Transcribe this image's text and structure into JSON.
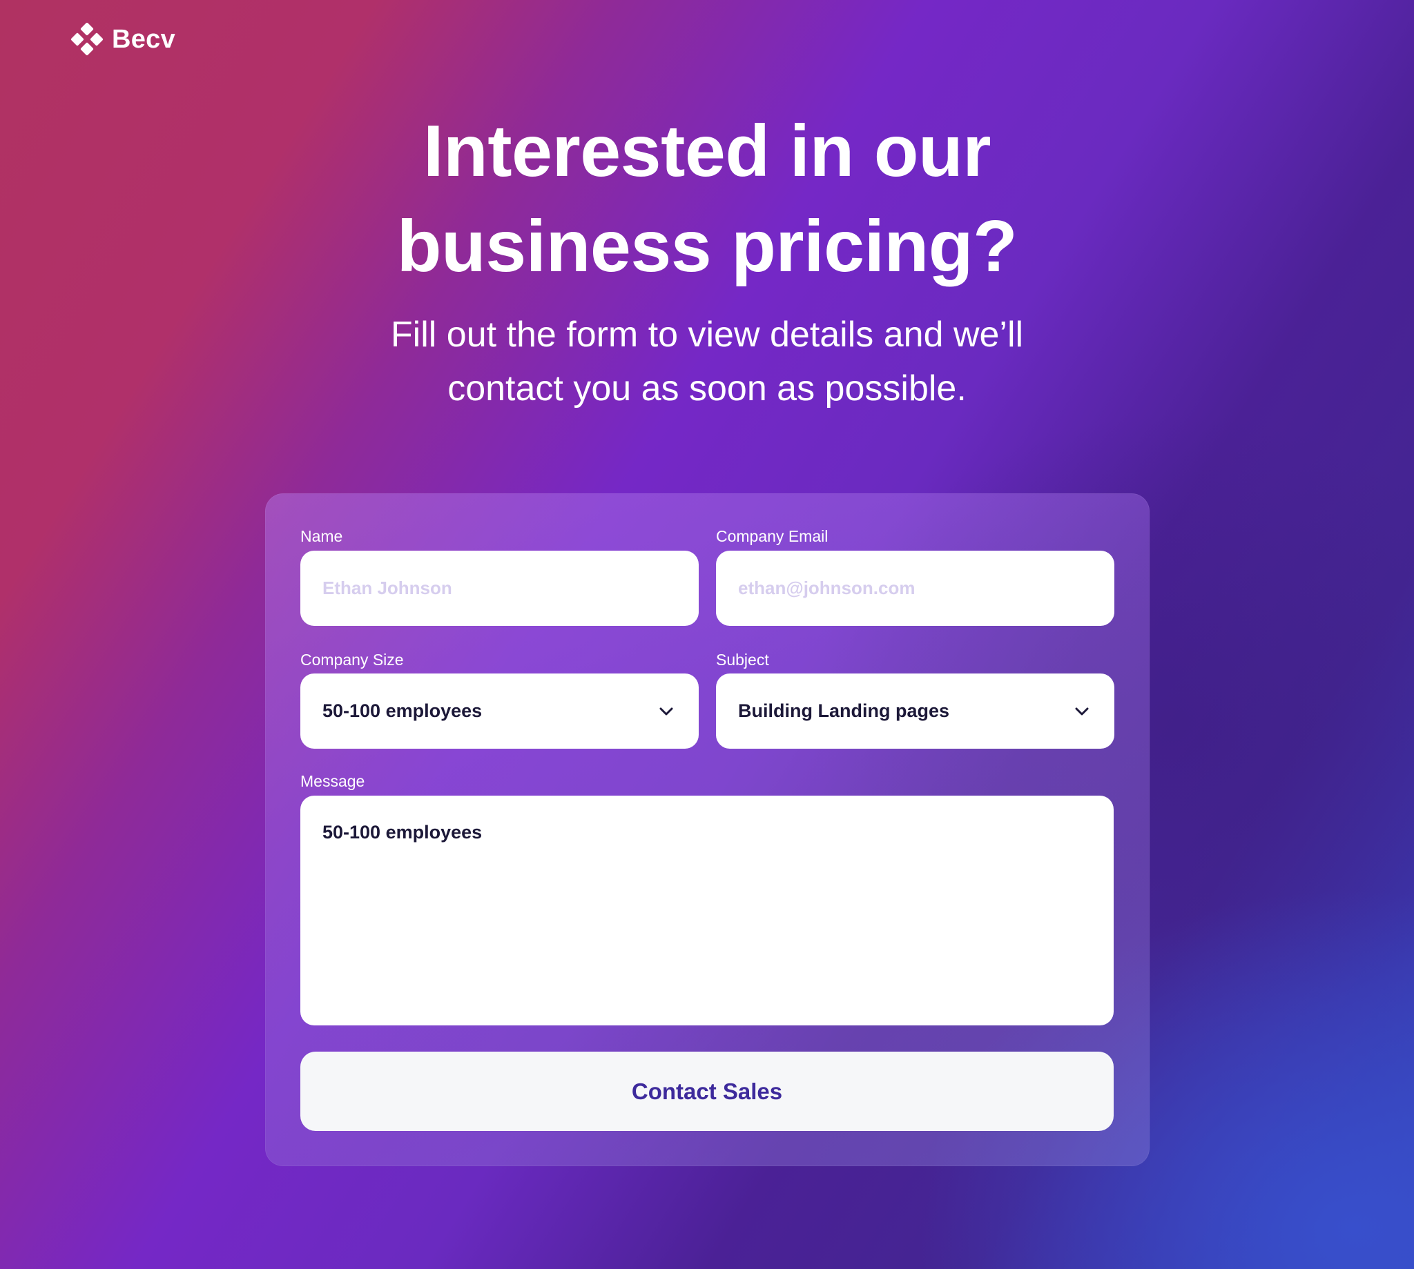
{
  "brand": {
    "name": "Becv",
    "logo_icon": "diamond-grid-logo-icon"
  },
  "hero": {
    "title_line1": "Interested in our",
    "title_line2": "business pricing?",
    "subtitle_line1": "Fill out the form to view details and we’ll",
    "subtitle_line2": "contact you as soon as possible."
  },
  "form": {
    "name": {
      "label": "Name",
      "placeholder": "Ethan Johnson",
      "value": ""
    },
    "email": {
      "label": "Company Email",
      "placeholder": "ethan@johnson.com",
      "value": ""
    },
    "company_size": {
      "label": "Company Size",
      "selected": "50-100 employees",
      "icon": "chevron-down-icon"
    },
    "subject": {
      "label": "Subject",
      "selected": "Building Landing pages",
      "icon": "chevron-down-icon"
    },
    "message": {
      "label": "Message",
      "value": "50-100 employees"
    },
    "submit_label": "Contact Sales"
  },
  "colors": {
    "gradient_start": "#b03262",
    "gradient_mid": "#7528c6",
    "gradient_end": "#3448be",
    "button_text": "#3d2a9c",
    "placeholder": "#d6cdee",
    "input_text": "#1c1838"
  }
}
